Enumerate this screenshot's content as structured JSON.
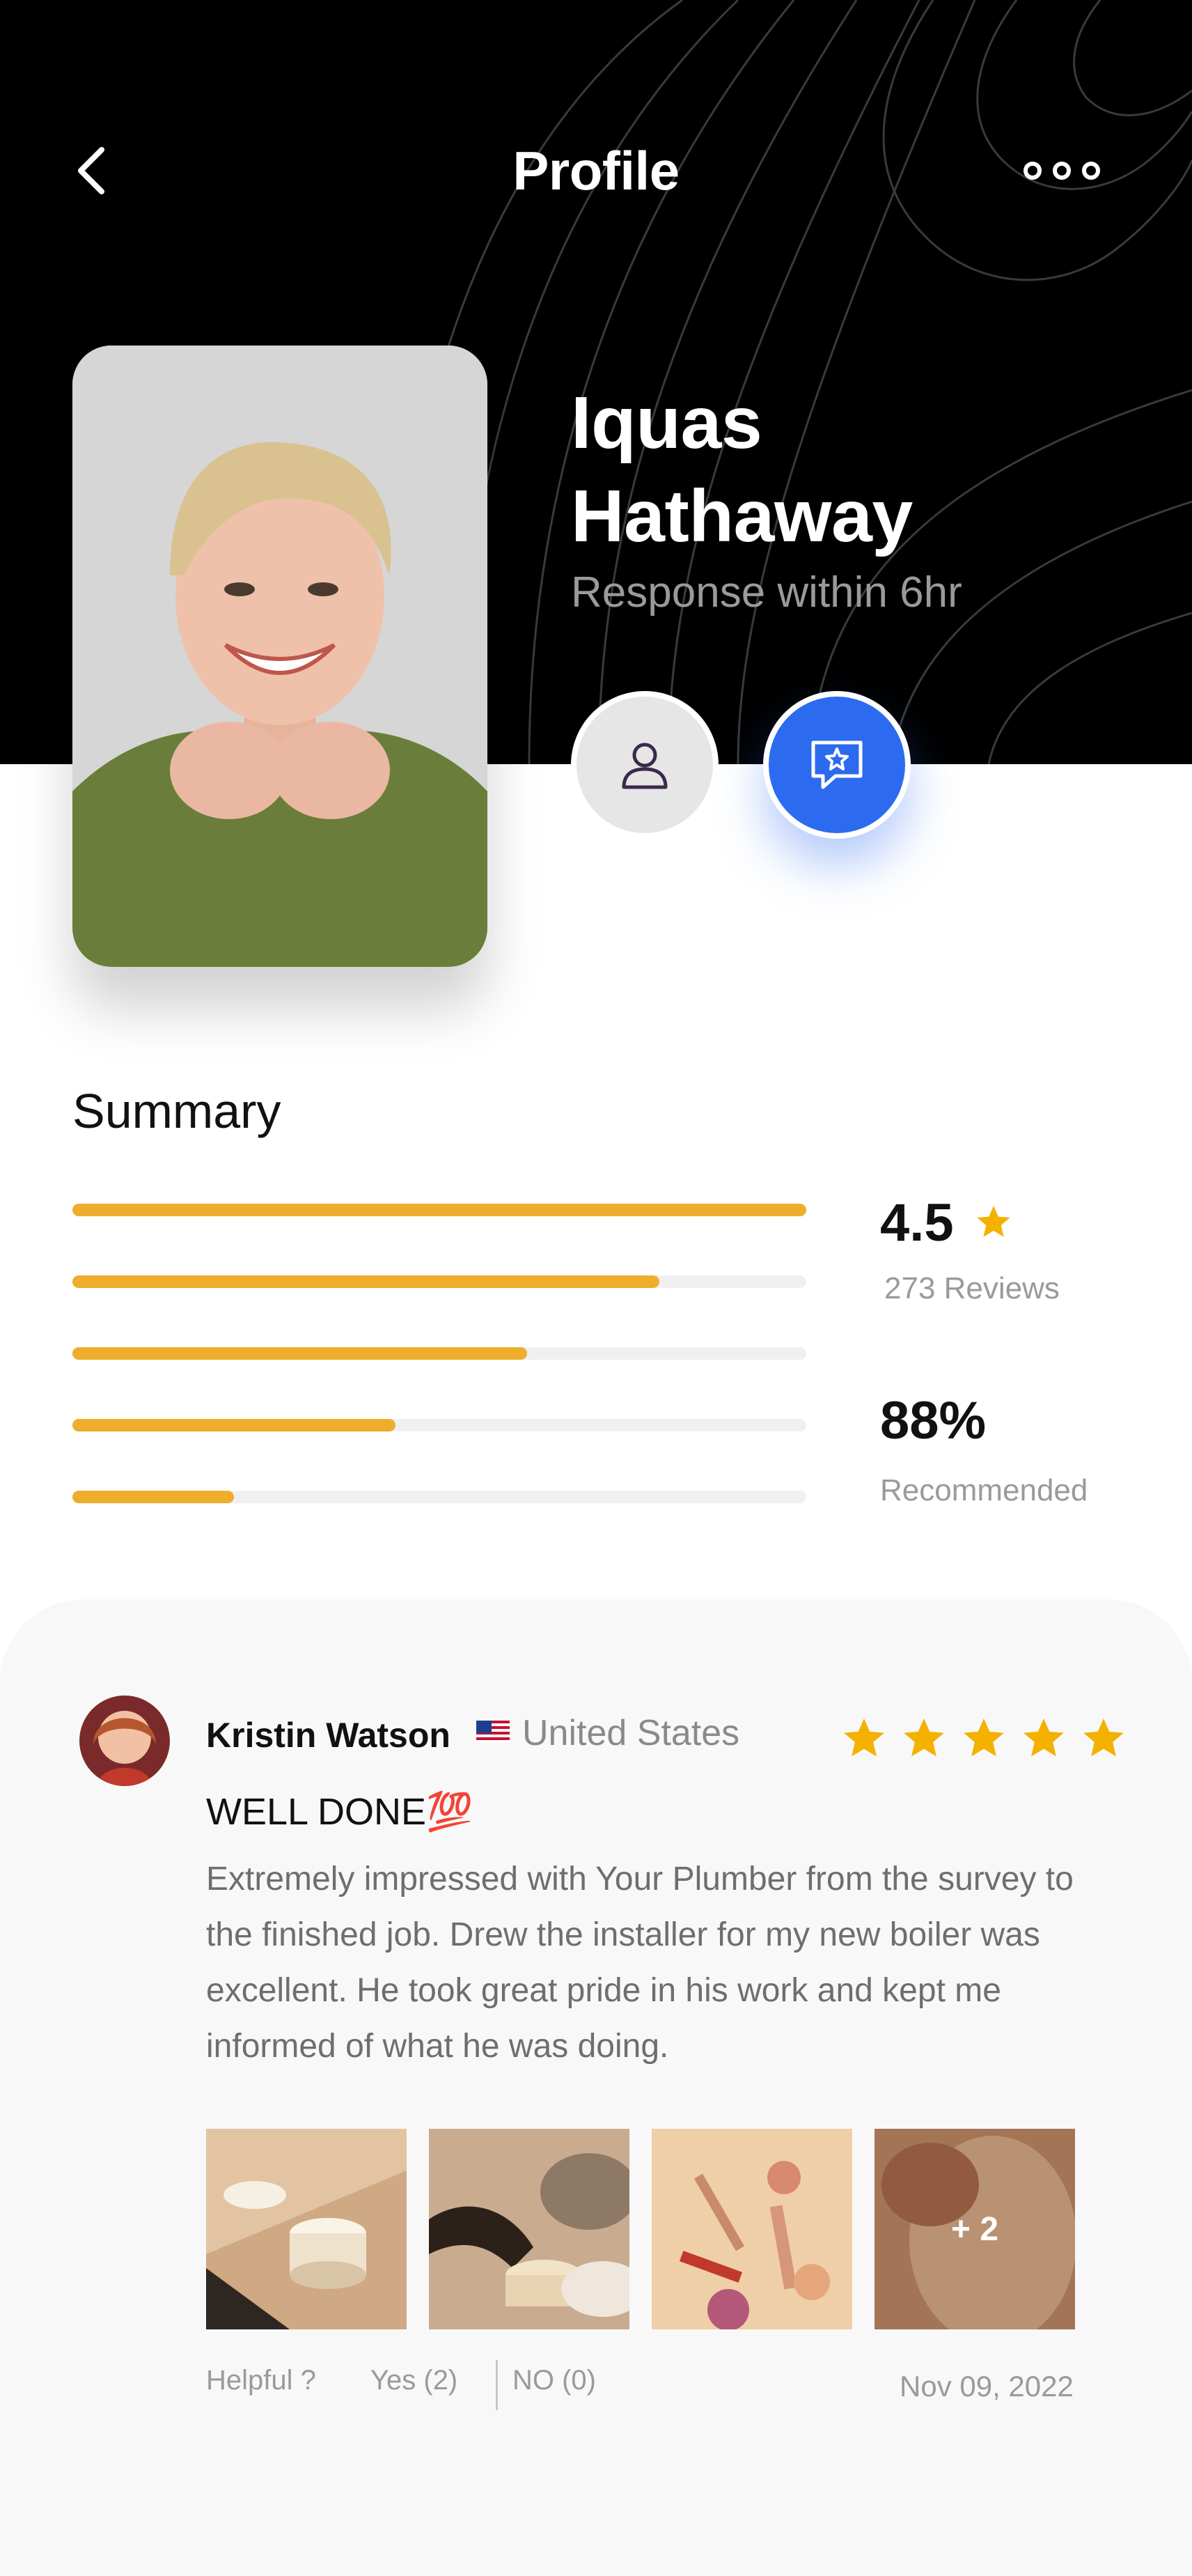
{
  "header": {
    "title": "Profile",
    "back_icon": "chevron-left-icon",
    "more_icon": "more-dots-icon"
  },
  "profile": {
    "first_name": "Iquas",
    "last_name": "Hathaway",
    "response": "Response within 6hr",
    "buttons": {
      "profile_icon": "user-icon",
      "review_icon": "chat-star-icon"
    }
  },
  "summary": {
    "title": "Summary",
    "rating": "4.5",
    "reviews": "273 Reviews",
    "recommended": "88%",
    "recommended_label": "Recommended",
    "bar_levels_percent": [
      100,
      80,
      62,
      44,
      22
    ],
    "accent_color": "#eeae2c"
  },
  "review": {
    "reviewer": "Kristin Watson",
    "country": "United States",
    "flag": "US",
    "stars": 5,
    "title": "WELL DONE💯",
    "body": "Extremely impressed with Your Plumber from the survey to the finished job. Drew the installer for my new boiler was excellent. He took great pride in his work and kept me informed of what he was doing.",
    "more_images": "+ 2",
    "helpful": "Helpful ?",
    "yes": "Yes (2)",
    "no": "NO (0)",
    "date": "Nov 09, 2022",
    "star_color": "#f5b100"
  },
  "colors": {
    "header_bg": "#000000",
    "primary_blue": "#2c6bf0"
  }
}
